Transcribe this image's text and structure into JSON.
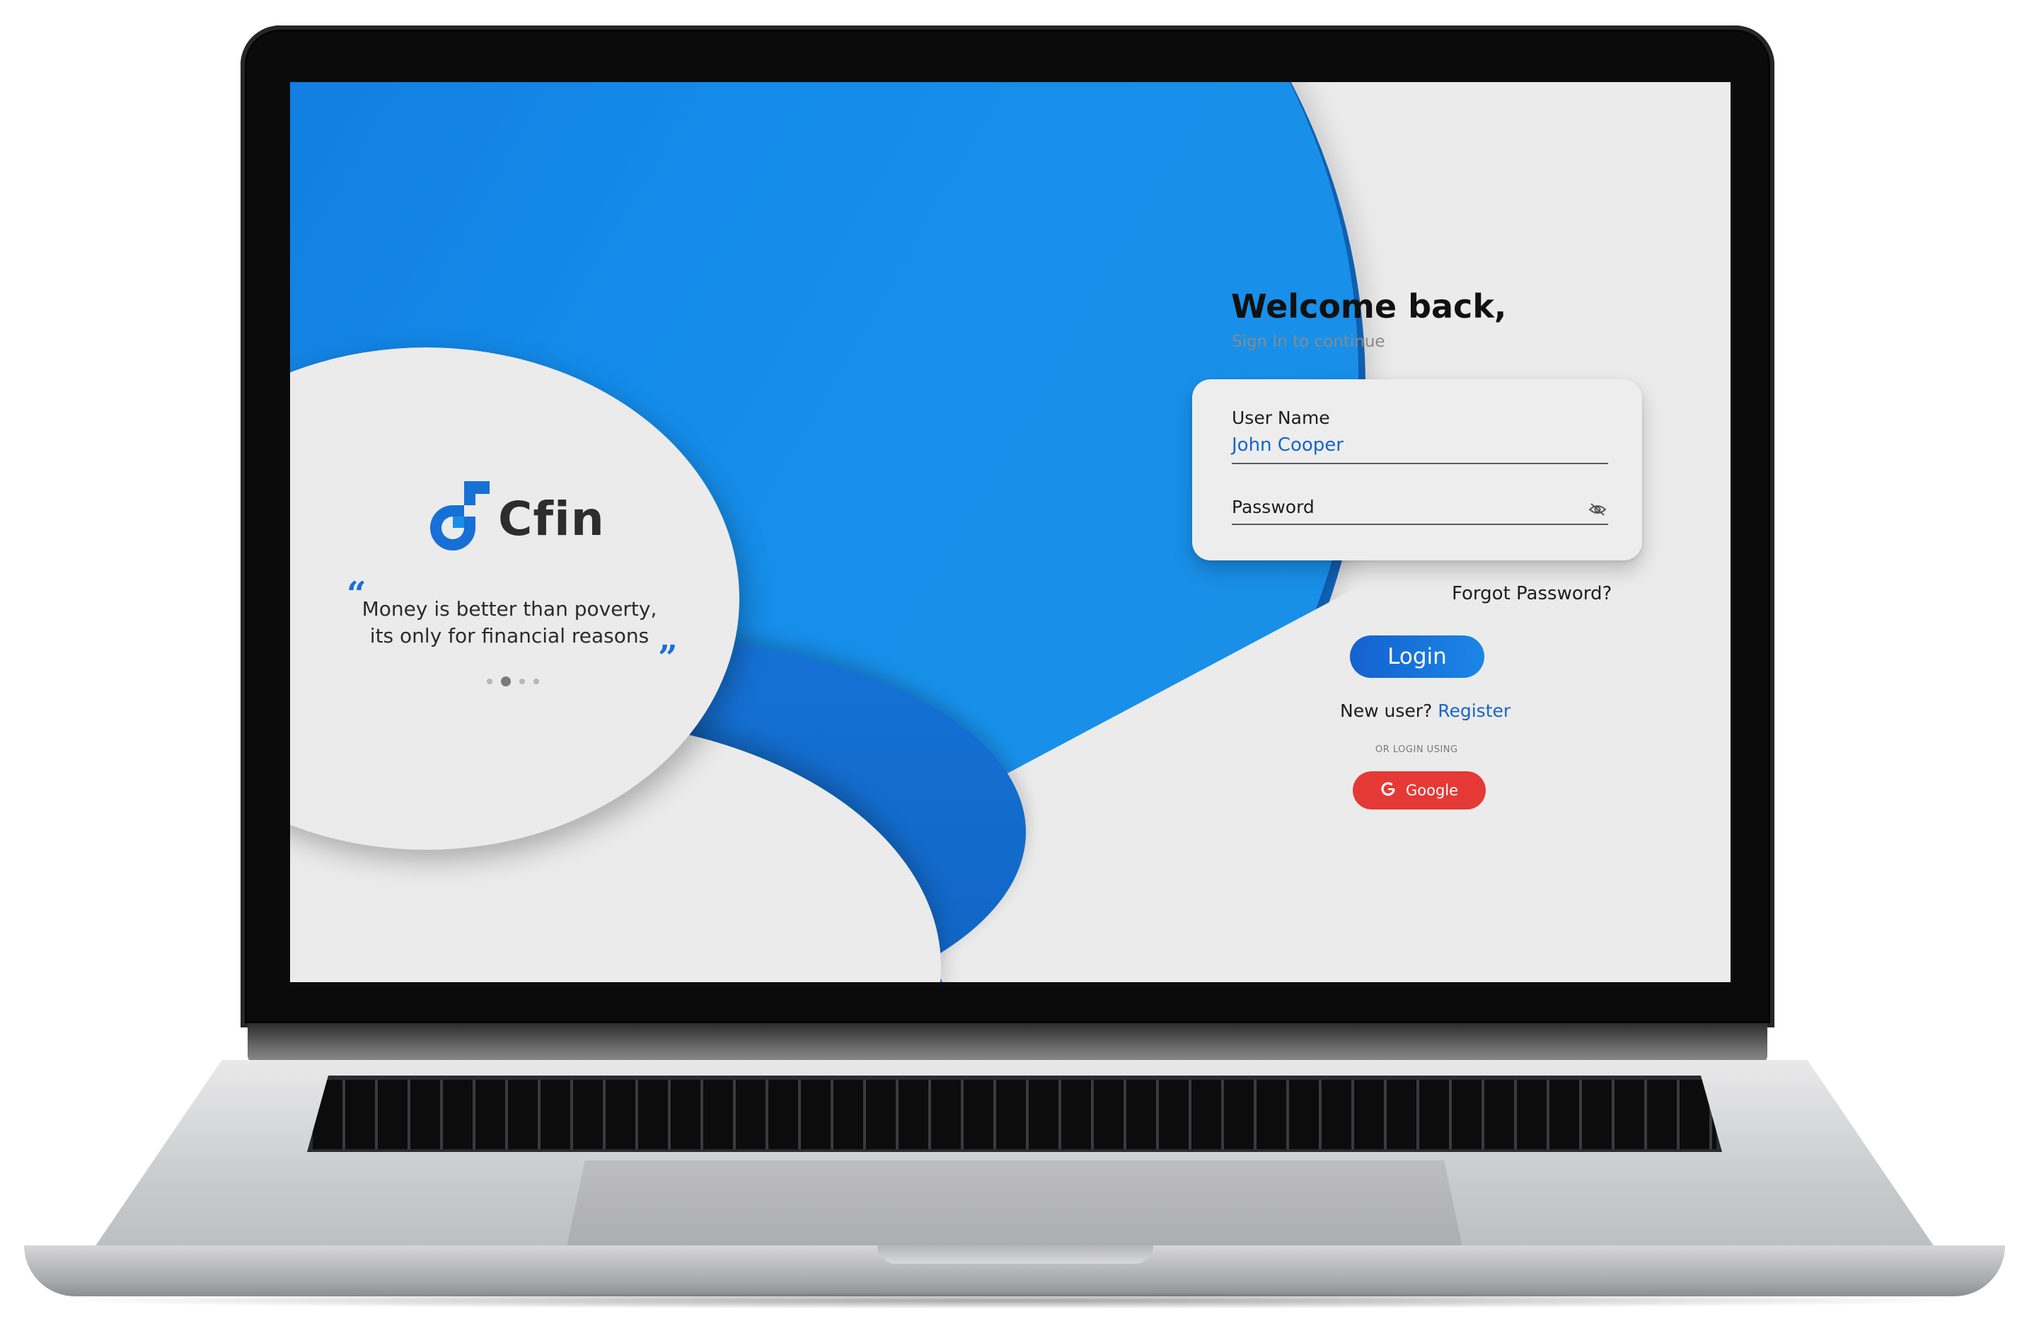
{
  "brand": {
    "name": "Cfin",
    "primary_color": "#1670D6",
    "accent_color": "#1A8EE6"
  },
  "hero": {
    "quote_open": "“",
    "quote_line1": "Money is better than poverty,",
    "quote_line2": "its only for financial reasons",
    "quote_close": "”",
    "carousel": {
      "total_slides": 4,
      "active_slide": 2
    }
  },
  "login": {
    "title": "Welcome back,",
    "subtitle": "Sign In to continue",
    "username_label": "User Name",
    "username_value": "John Cooper",
    "password_label": "Password",
    "password_visibility_icon": "eye-off-icon",
    "forgot_password": "Forgot Password?",
    "login_button": "Login",
    "new_user_text": "New user?",
    "register_link": "Register",
    "alt_login_label": "OR LOGIN USING",
    "google_button": "Google",
    "google_icon": "google-g-icon",
    "google_button_color": "#E53935"
  }
}
